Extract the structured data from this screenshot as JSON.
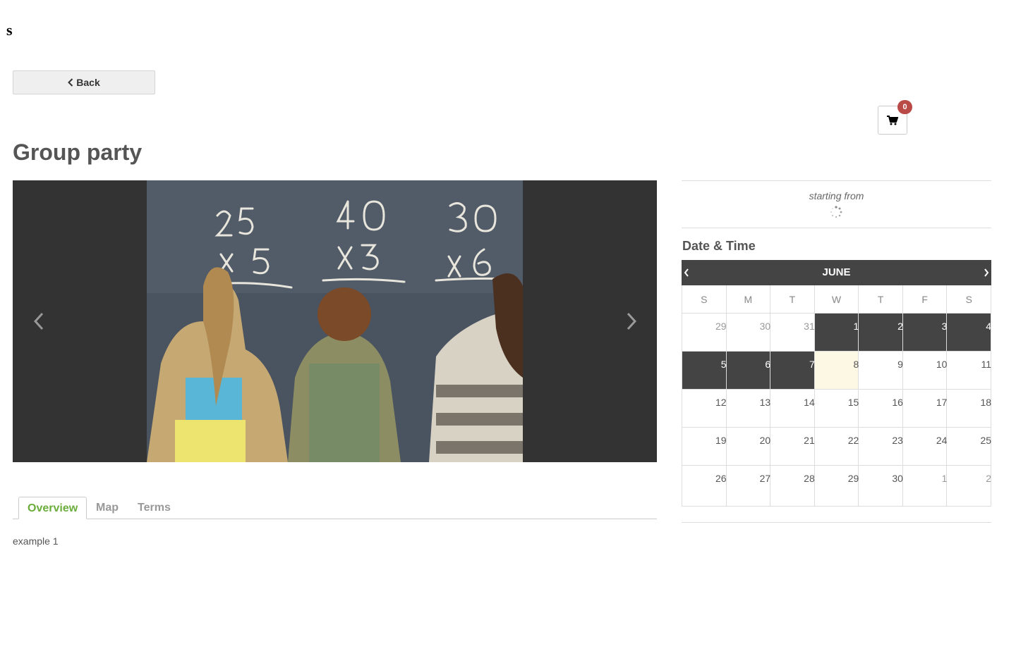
{
  "logo": {
    "text": "s"
  },
  "back_button": {
    "label": "Back"
  },
  "cart": {
    "count": "0"
  },
  "page_title": "Group party",
  "tabs": [
    {
      "label": "Overview",
      "active": true
    },
    {
      "label": "Map",
      "active": false
    },
    {
      "label": "Terms",
      "active": false
    }
  ],
  "overview_text": "example 1",
  "pricing": {
    "starting_from": "starting from"
  },
  "date_time": {
    "title": "Date & Time",
    "month": "JUNE",
    "weekdays": [
      "S",
      "M",
      "T",
      "W",
      "T",
      "F",
      "S"
    ],
    "weeks": [
      [
        {
          "d": "29",
          "s": "other"
        },
        {
          "d": "30",
          "s": "other"
        },
        {
          "d": "31",
          "s": "other"
        },
        {
          "d": "1",
          "s": "disabled"
        },
        {
          "d": "2",
          "s": "disabled"
        },
        {
          "d": "3",
          "s": "disabled"
        },
        {
          "d": "4",
          "s": "disabled"
        }
      ],
      [
        {
          "d": "5",
          "s": "disabled"
        },
        {
          "d": "6",
          "s": "disabled"
        },
        {
          "d": "7",
          "s": "disabled"
        },
        {
          "d": "8",
          "s": "today"
        },
        {
          "d": "9",
          "s": ""
        },
        {
          "d": "10",
          "s": ""
        },
        {
          "d": "11",
          "s": ""
        }
      ],
      [
        {
          "d": "12",
          "s": ""
        },
        {
          "d": "13",
          "s": ""
        },
        {
          "d": "14",
          "s": ""
        },
        {
          "d": "15",
          "s": ""
        },
        {
          "d": "16",
          "s": ""
        },
        {
          "d": "17",
          "s": ""
        },
        {
          "d": "18",
          "s": ""
        }
      ],
      [
        {
          "d": "19",
          "s": ""
        },
        {
          "d": "20",
          "s": ""
        },
        {
          "d": "21",
          "s": ""
        },
        {
          "d": "22",
          "s": ""
        },
        {
          "d": "23",
          "s": ""
        },
        {
          "d": "24",
          "s": ""
        },
        {
          "d": "25",
          "s": ""
        }
      ],
      [
        {
          "d": "26",
          "s": ""
        },
        {
          "d": "27",
          "s": ""
        },
        {
          "d": "28",
          "s": ""
        },
        {
          "d": "29",
          "s": ""
        },
        {
          "d": "30",
          "s": ""
        },
        {
          "d": "1",
          "s": "other"
        },
        {
          "d": "2",
          "s": "other"
        }
      ]
    ]
  },
  "colors": {
    "accent": "#6aad3a",
    "badge": "#b94a48",
    "dark": "#444444",
    "today": "#fcf8e3"
  }
}
